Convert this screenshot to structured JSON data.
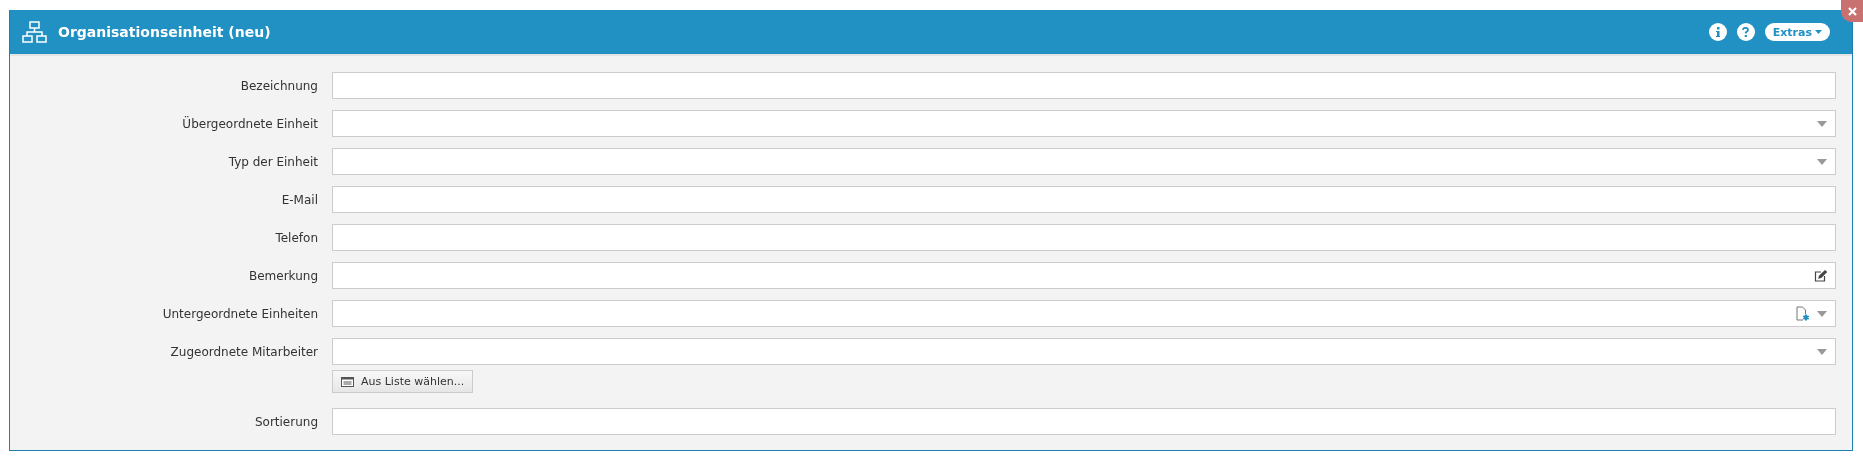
{
  "window": {
    "title": "Organisationseinheit (neu)",
    "extras_label": "Extras"
  },
  "fields": [
    {
      "label": "Bezeichnung",
      "kind": "text"
    },
    {
      "label": "Übergeordnete Einheit",
      "kind": "select"
    },
    {
      "label": "Typ der Einheit",
      "kind": "select"
    },
    {
      "label": "E-Mail",
      "kind": "text"
    },
    {
      "label": "Telefon",
      "kind": "text"
    },
    {
      "label": "Bemerkung",
      "kind": "memo"
    },
    {
      "label": "Untergeordnete Einheiten",
      "kind": "select-new"
    },
    {
      "label": "Zugeordnete Mitarbeiter",
      "kind": "select",
      "button": "Aus Liste wählen..."
    },
    {
      "label": "Sortierung",
      "kind": "text"
    }
  ]
}
